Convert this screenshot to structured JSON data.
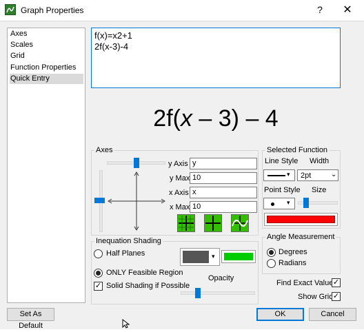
{
  "window": {
    "title": "Graph Properties",
    "help": "?",
    "close": "✕"
  },
  "nav": {
    "items": [
      "Axes",
      "Scales",
      "Grid",
      "Function Properties",
      "Quick Entry"
    ],
    "selected_index": 4
  },
  "entry": {
    "lines": [
      "f(x)=x2+1",
      "2f(x-3)-4"
    ]
  },
  "preview": {
    "pre": "2f(",
    "var": "x",
    "post": " – 3) – 4"
  },
  "axes": {
    "title": "Axes",
    "y_axis_label": "y Axis",
    "y_axis_value": "y",
    "y_max_label": "y Max",
    "y_max_value": "10",
    "x_axis_label": "x Axis",
    "x_axis_value": "x",
    "x_max_label": "x Max",
    "x_max_value": "10"
  },
  "selected_function": {
    "title": "Selected Function",
    "line_style_label": "Line Style",
    "width_label": "Width",
    "width_value": "2pt",
    "point_style_label": "Point Style",
    "size_label": "Size",
    "color": "#ff0000"
  },
  "inequation": {
    "title": "Inequation Shading",
    "half_planes": "Half Planes",
    "only_feasible": "ONLY Feasible Region",
    "solid_shading": "Solid Shading if Possible",
    "opacity_label": "Opacity",
    "shade_color": "#555555",
    "feasible_color": "#00cc00"
  },
  "angle": {
    "title": "Angle Measurement",
    "degrees": "Degrees",
    "radians": "Radians"
  },
  "options": {
    "find_exact": "Find Exact Values",
    "show_grid": "Show Grid"
  },
  "buttons": {
    "set_default": "Set As Default",
    "ok": "OK",
    "cancel": "Cancel"
  },
  "colors": {
    "accent": "#0078d7",
    "green": "#33bf00"
  }
}
